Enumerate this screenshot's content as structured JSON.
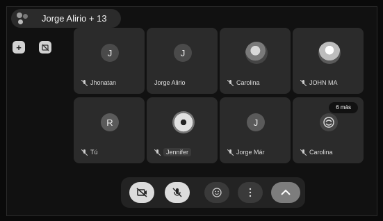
{
  "header": {
    "title": "Jorge Alirio + 13"
  },
  "toolbar": {
    "add_label": "+"
  },
  "tiles": [
    {
      "name": "Jhonatan",
      "initial": "J",
      "avatar_color": "#4a4a4a"
    },
    {
      "name": "Jorge Alirio",
      "initial": "J",
      "avatar_color": "#4a4a4a"
    },
    {
      "name": "Carolina",
      "initial": "",
      "avatar_color": "#666666"
    },
    {
      "name": "JOHN MA",
      "initial": "",
      "avatar_color": "#777777"
    },
    {
      "name": "Tú",
      "initial": "R",
      "avatar_color": "#5a5a5a"
    },
    {
      "name": "Jennifer",
      "initial": "",
      "avatar_color": "#777777"
    },
    {
      "name": "Jorge Már",
      "initial": "J",
      "avatar_color": "#5a5a5a"
    },
    {
      "name": "Carolina",
      "initial": "",
      "avatar_color": "#444444"
    }
  ],
  "more_badge": "6 más"
}
